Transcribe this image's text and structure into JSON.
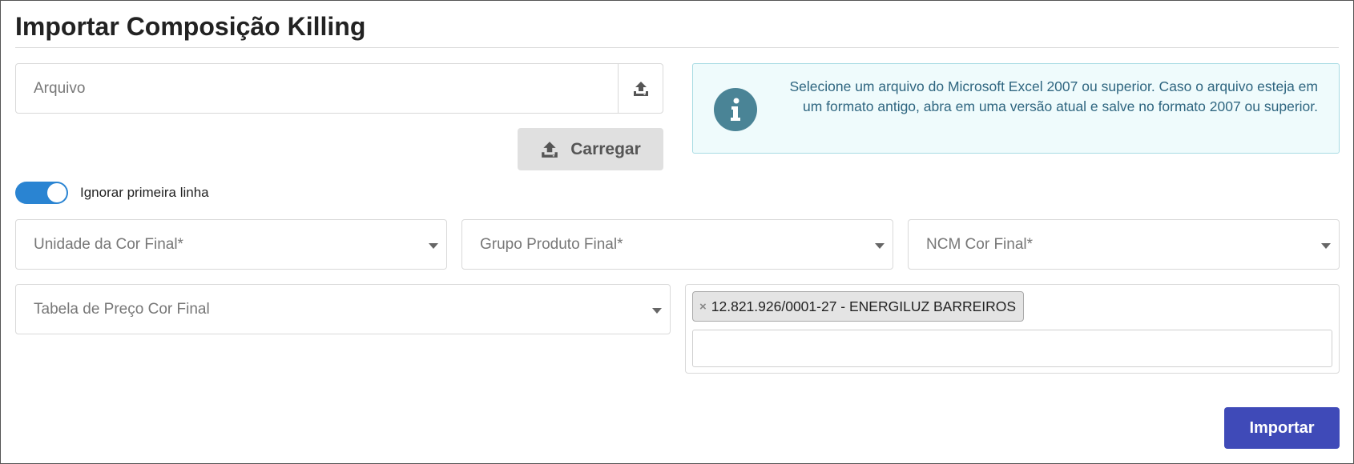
{
  "page": {
    "title": "Importar Composição Killing"
  },
  "file": {
    "placeholder": "Arquivo",
    "upload_icon": "upload-icon"
  },
  "load_button": {
    "label": "Carregar",
    "icon": "upload-icon"
  },
  "info": {
    "icon": "info-icon",
    "text": "Selecione um arquivo do Microsoft Excel 2007 ou superior. Caso o arquivo esteja em um formato antigo, abra em uma versão atual e salve no formato 2007 ou superior."
  },
  "toggle": {
    "label": "Ignorar primeira linha",
    "checked": true
  },
  "selects": {
    "unidade": "Unidade da Cor Final*",
    "grupo": "Grupo Produto Final*",
    "ncm": "NCM Cor Final*",
    "tabela": "Tabela de Preço Cor Final"
  },
  "multiselect": {
    "tags": [
      {
        "remove": "×",
        "label": "12.821.926/0001-27 - ENERGILUZ BARREIROS"
      }
    ]
  },
  "import_button": {
    "label": "Importar"
  },
  "colors": {
    "primary": "#3f4ab8",
    "toggle_on": "#2a84d2",
    "info_bg": "#effbfc",
    "info_text": "#2f6680"
  }
}
